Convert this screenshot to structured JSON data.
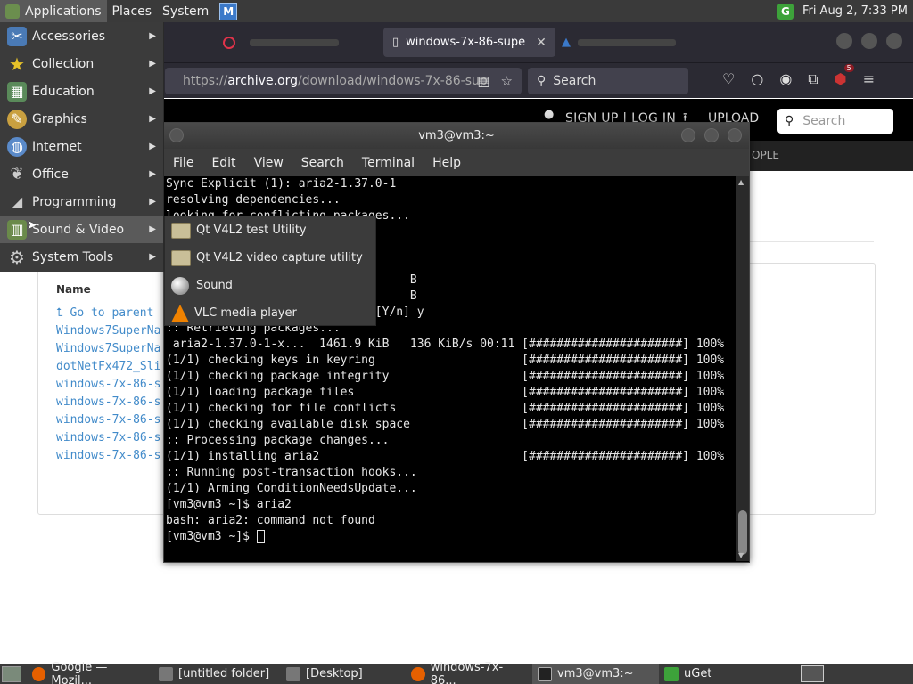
{
  "top_panel": {
    "applications": "Applications",
    "places": "Places",
    "system": "System",
    "datetime": "Fri Aug 2,  7:33 PM",
    "uget_letter": "G"
  },
  "browser": {
    "tabs": [
      {
        "label": "",
        "active": false
      },
      {
        "label": "windows-7x-86-supe",
        "active": true
      },
      {
        "label": "",
        "active": false
      }
    ],
    "url_prefix": "https://",
    "url_host": "archive.org",
    "url_path": "/download/windows-7x-86-sup",
    "search_placeholder": "Search",
    "ublock_badge": "5"
  },
  "archive": {
    "signup": "SIGN UP | LOG IN",
    "upload": "UPLOAD",
    "search_placeholder": "Search",
    "people": "OPLE",
    "listing_header": "Name",
    "rows": [
      "⮤ Go to parent",
      "Windows7SuperNa",
      "Windows7SuperNa",
      "dotNetFx472_Sli",
      "windows-7x-86-s",
      "windows-7x-86-s",
      "windows-7x-86-s",
      "windows-7x-86-s",
      "windows-7x-86-s"
    ]
  },
  "apps_menu": {
    "items": [
      {
        "label": "Accessories",
        "icon": "accessories-icon",
        "color": "#4a7ab5"
      },
      {
        "label": "Collection",
        "icon": "star-icon",
        "color": "#e6c229"
      },
      {
        "label": "Education",
        "icon": "education-icon",
        "color": "#5a8a5a"
      },
      {
        "label": "Graphics",
        "icon": "graphics-icon",
        "color": "#c9a040"
      },
      {
        "label": "Internet",
        "icon": "globe-icon",
        "color": "#5a8ac9"
      },
      {
        "label": "Office",
        "icon": "office-icon",
        "color": "#888888"
      },
      {
        "label": "Programming",
        "icon": "programming-icon",
        "color": "#aaaaaa"
      },
      {
        "label": "Sound & Video",
        "icon": "film-icon",
        "color": "#6a8a4a"
      },
      {
        "label": "System Tools",
        "icon": "gear-icon",
        "color": "#999999"
      }
    ]
  },
  "submenu": {
    "items": [
      "Qt V4L2 test Utility",
      "Qt V4L2 video capture utility",
      "Sound",
      "VLC media player"
    ]
  },
  "terminal": {
    "title": "vm3@vm3:~",
    "menus": [
      "File",
      "Edit",
      "View",
      "Search",
      "Terminal",
      "Help"
    ],
    "lines": [
      "Sync Explicit (1): aria2-1.37.0-1",
      "resolving dependencies...",
      "looking for conflicting packages...",
      "",
      "",
      "",
      "                                   B",
      "                                   B",
      ":: Proceed with installation? [Y/n] y",
      ":: Retrieving packages...",
      " aria2-1.37.0-1-x...  1461.9 KiB   136 KiB/s 00:11 [######################] 100%",
      "(1/1) checking keys in keyring                     [######################] 100%",
      "(1/1) checking package integrity                   [######################] 100%",
      "(1/1) loading package files                        [######################] 100%",
      "(1/1) checking for file conflicts                  [######################] 100%",
      "(1/1) checking available disk space                [######################] 100%",
      ":: Processing package changes...",
      "(1/1) installing aria2                             [######################] 100%",
      ":: Running post-transaction hooks...",
      "(1/1) Arming ConditionNeedsUpdate...",
      "[vm3@vm3 ~]$ aria2",
      "bash: aria2: command not found"
    ],
    "prompt": "[vm3@vm3 ~]$ "
  },
  "taskbar": {
    "tasks": [
      {
        "label": "Google — Mozil...",
        "icon": "firefox-icon",
        "color": "#e66000",
        "active": false
      },
      {
        "label": "[untitled folder]",
        "icon": "folder-icon",
        "color": "#777777",
        "active": false
      },
      {
        "label": "[Desktop]",
        "icon": "folder-icon",
        "color": "#777777",
        "active": false
      },
      {
        "label": "windows-7x-86...",
        "icon": "firefox-icon",
        "color": "#e66000",
        "active": false
      },
      {
        "label": "vm3@vm3:~",
        "icon": "terminal-icon",
        "color": "#222222",
        "active": true
      },
      {
        "label": "uGet",
        "icon": "uget-icon",
        "color": "#3da23a",
        "active": false
      }
    ]
  }
}
